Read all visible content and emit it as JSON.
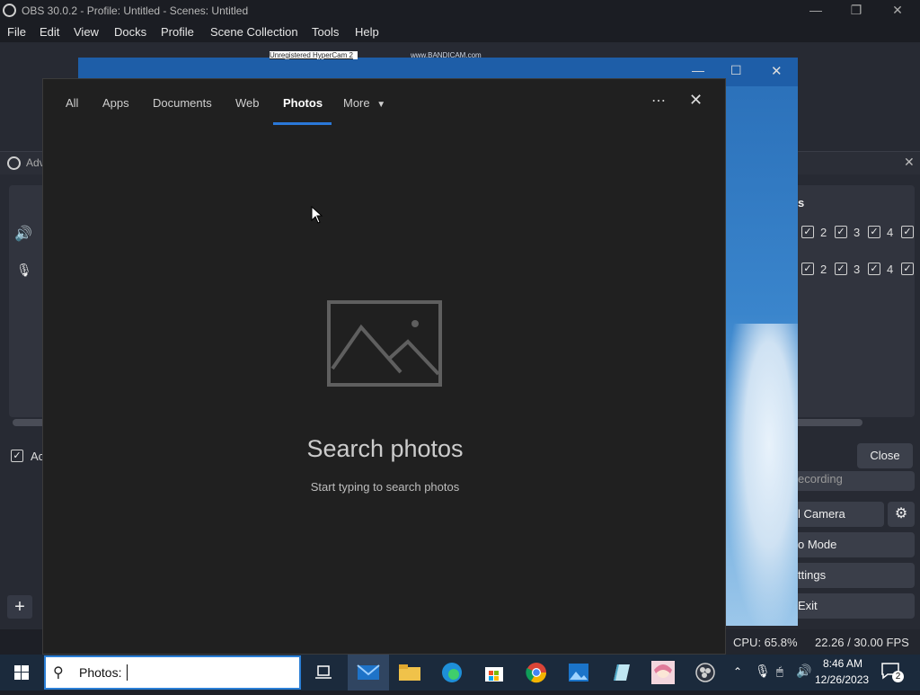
{
  "obs": {
    "title": "OBS 30.0.2 - Profile: Untitled - Scenes: Untitled",
    "menu": [
      "File",
      "Edit",
      "View",
      "Docks",
      "Profile",
      "Scene Collection",
      "Tools",
      "Help"
    ],
    "adv_title_fragment": "Adv",
    "adv_checkbox_fragment": "Ac",
    "close_label": "Close",
    "track_labels": [
      "2",
      "3",
      "4"
    ],
    "controls": {
      "recording": "ecording",
      "camera": "l Camera",
      "studio_mode": "o Mode",
      "settings": "ttings",
      "exit": "Exit"
    },
    "section_fragment": "s",
    "status": {
      "cpu": "CPU: 65.8%",
      "fps": "22.26 / 30.00 FPS"
    }
  },
  "bandicam_header": "Unregistered HyperCam 2",
  "bandicam_brand": "www.BANDICAM.com",
  "search": {
    "tabs": [
      "All",
      "Apps",
      "Documents",
      "Web",
      "Photos",
      "More"
    ],
    "active_tab": "Photos",
    "heading": "Search photos",
    "subtext": "Start typing to search photos",
    "query": "Photos: "
  },
  "taskbar": {
    "time": "8:46 AM",
    "date": "12/26/2023",
    "notification_count": "2",
    "icons": [
      "task-view",
      "mail",
      "file-explorer",
      "edge",
      "store",
      "chrome",
      "photos",
      "notepad",
      "avatar-app",
      "obs"
    ]
  },
  "colors": {
    "accent": "#2a78d8",
    "panel": "#202020",
    "taskbar": "#1b2a3c"
  }
}
